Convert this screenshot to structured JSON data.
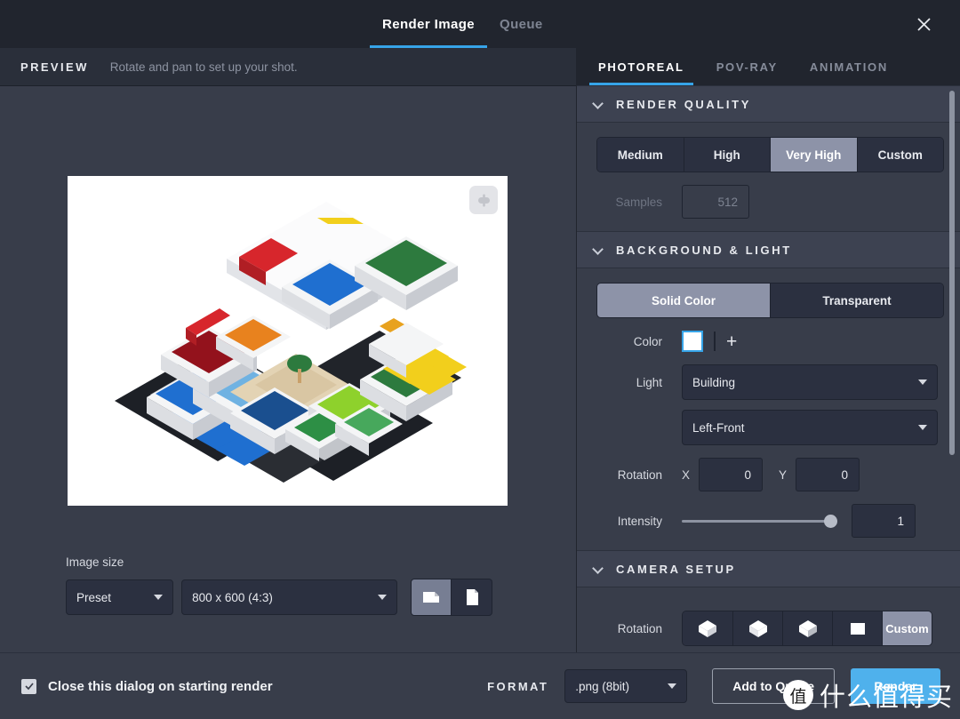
{
  "window": {
    "tabs": [
      {
        "label": "Render Image",
        "active": true
      },
      {
        "label": "Queue",
        "active": false
      }
    ],
    "close_icon": "close-icon"
  },
  "preview": {
    "title": "PREVIEW",
    "subtitle": "Rotate and pan to set up your shot.",
    "canvas_background": "#ffffff",
    "tool_icon": "link-icon",
    "image_size": {
      "label": "Image size",
      "preset_mode": "Preset",
      "dimension": "800 x 600 (4:3)",
      "orientation": [
        {
          "icon": "page-landscape-icon",
          "active": true
        },
        {
          "icon": "page-portrait-icon",
          "active": false
        }
      ]
    }
  },
  "settings": {
    "tabs": [
      {
        "label": "PHOTOREAL",
        "active": true
      },
      {
        "label": "POV-RAY",
        "active": false
      },
      {
        "label": "ANIMATION",
        "active": false
      }
    ],
    "render_quality": {
      "title": "RENDER QUALITY",
      "options": [
        {
          "label": "Medium",
          "active": false
        },
        {
          "label": "High",
          "active": false
        },
        {
          "label": "Very High",
          "active": true
        },
        {
          "label": "Custom",
          "active": false
        }
      ],
      "samples_label": "Samples",
      "samples_value": "512",
      "samples_disabled": true
    },
    "background_light": {
      "title": "BACKGROUND & LIGHT",
      "modes": [
        {
          "label": "Solid Color",
          "active": true
        },
        {
          "label": "Transparent",
          "active": false
        }
      ],
      "color_label": "Color",
      "color_value": "#ffffff",
      "color_selection_border": "#36a4e8",
      "add_color_label": "+",
      "light_label": "Light",
      "light_source": "Building",
      "light_direction": "Left-Front",
      "rotation_label": "Rotation",
      "rotation_x_label": "X",
      "rotation_x": "0",
      "rotation_y_label": "Y",
      "rotation_y": "0",
      "intensity_label": "Intensity",
      "intensity_value": "1",
      "intensity_percent": 100
    },
    "camera_setup": {
      "title": "CAMERA SETUP",
      "rotation_label": "Rotation",
      "presets": [
        {
          "icon": "cube-view-1-icon",
          "label": "",
          "active": false
        },
        {
          "icon": "cube-view-2-icon",
          "label": "",
          "active": false
        },
        {
          "icon": "cube-view-3-icon",
          "label": "",
          "active": false
        },
        {
          "icon": "cube-front-icon",
          "label": "",
          "active": false
        },
        {
          "icon": "custom-view",
          "label": "Custom",
          "active": true
        }
      ]
    }
  },
  "footer": {
    "close_dialog_label": "Close this dialog on starting render",
    "close_dialog_checked": true,
    "format_label": "FORMAT",
    "format_value": ".png (8bit)",
    "add_to_queue_label": "Add to Queue",
    "render_label": "Render",
    "render_color": "#4fb1ec"
  },
  "watermark": {
    "logo_char": "值",
    "text": "什么值得买"
  }
}
